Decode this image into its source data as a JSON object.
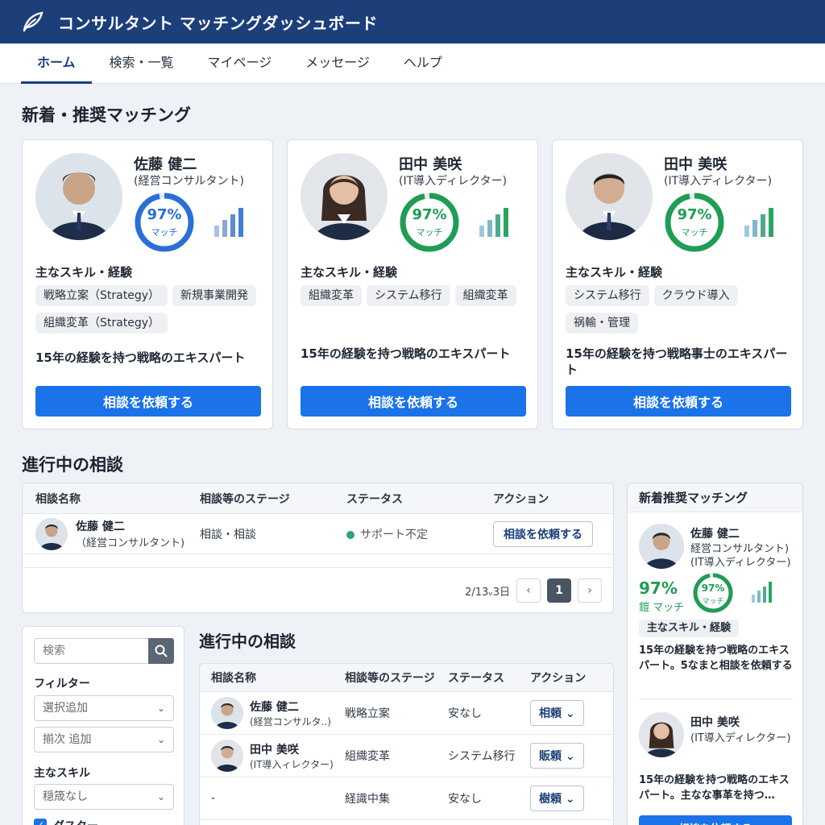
{
  "app": {
    "title": "コンサルタント マッチングダッシュボード"
  },
  "nav": {
    "tabs": [
      "ホーム",
      "検索・一覧",
      "マイページ",
      "メッセージ",
      "ヘルプ"
    ]
  },
  "recommendations": {
    "title": "新着・推奨マッチング",
    "skills_heading": "主なスキル・経験",
    "match_label": "マッチ",
    "cta": "相談を依頼する",
    "cards": [
      {
        "name": "佐藤 健二",
        "role": "(経営コンサルタント)",
        "match": "97%",
        "ring_color": "#2a6fd6",
        "bar_color": "#3f7fd4",
        "skills": [
          "戦略立案（Strategy）",
          "新規事業開発",
          "組織変革（Strategy）"
        ],
        "description": "15年の経験を持つ戦略のエキスパート"
      },
      {
        "name": "田中 美咲",
        "role": "(IT導入ディレクター)",
        "match": "97%",
        "ring_color": "#1f9d55",
        "bar_color": "#2aa562",
        "skills": [
          "組織変革",
          "システム移行",
          "組織変革"
        ],
        "description": "15年の経験を持つ戦略のエキスパート"
      },
      {
        "name": "田中 美咲",
        "role": "(IT導入ディレクター)",
        "match": "97%",
        "ring_color": "#1f9d55",
        "bar_color": "#2aa562",
        "skills": [
          "システム移行",
          "クラウド導入",
          "祸輸・管理"
        ],
        "description": "15年の経験を持つ戦略事士のエキスパート"
      }
    ]
  },
  "active1": {
    "title": "進行中の相談",
    "headers": [
      "相談名称",
      "相談等のステージ",
      "ステータス",
      "アクション"
    ],
    "rows": [
      {
        "name": "佐藤 健二",
        "role": "（経営コンサルタント)",
        "stage": "相談・相談",
        "status": "サポート不定",
        "action": "相談を依頼する"
      }
    ],
    "pager": {
      "info": "2/13ᵥ3日",
      "prev": "‹",
      "page": "1",
      "next": "›"
    }
  },
  "filters": {
    "search_placeholder": "検索",
    "filter_label": "フィルター",
    "select1": "選択追加",
    "select2": "揃次 追加",
    "skill_label": "主なスキル",
    "select3": "穏筬なし",
    "checkbox_label": "ダスター"
  },
  "active2": {
    "title": "進行中の相談",
    "headers": [
      "相談名称",
      "相談等のステージ",
      "ステータス",
      "アクション"
    ],
    "rows": [
      {
        "name": "佐藤 健二",
        "role": "(経営コンサルタ..)",
        "stage": "戦略立案",
        "status": "安なし",
        "action": "相頼"
      },
      {
        "name": "田中 美咲",
        "role": "(IT導入ィレクター)",
        "stage": "組織変革",
        "status": "システム移行",
        "action": "販頼"
      },
      {
        "name": "-",
        "role": "",
        "stage": "経識中集",
        "status": "安なし",
        "action": "樹頼"
      }
    ]
  },
  "side": {
    "title": "新着推奨マッチング",
    "item1": {
      "name": "佐藤 健二",
      "role1": "経営コンサルタント)",
      "role2": "(IT導入ディレクター)",
      "pct": "97%",
      "match_text": "鎧 マッチ",
      "ring_pct": "97%",
      "ring_label": "マッチ",
      "skills": "主なスキル・経験",
      "desc": "15年の経験を持つ戦略のエキスパート。5なまと相談を依頼する"
    },
    "item2": {
      "name": "田中 美咲",
      "role": "(IT導入ディレクター)",
      "desc": "15年の経験を持つ戦略のエキスパート。主なな事革を持つ…",
      "cta": "相談を依頼する"
    }
  },
  "colors": {
    "header": "#1c3f7a",
    "primary_button": "#1a73e8",
    "match_blue": "#2a6fd6",
    "match_green": "#1f9d55"
  }
}
